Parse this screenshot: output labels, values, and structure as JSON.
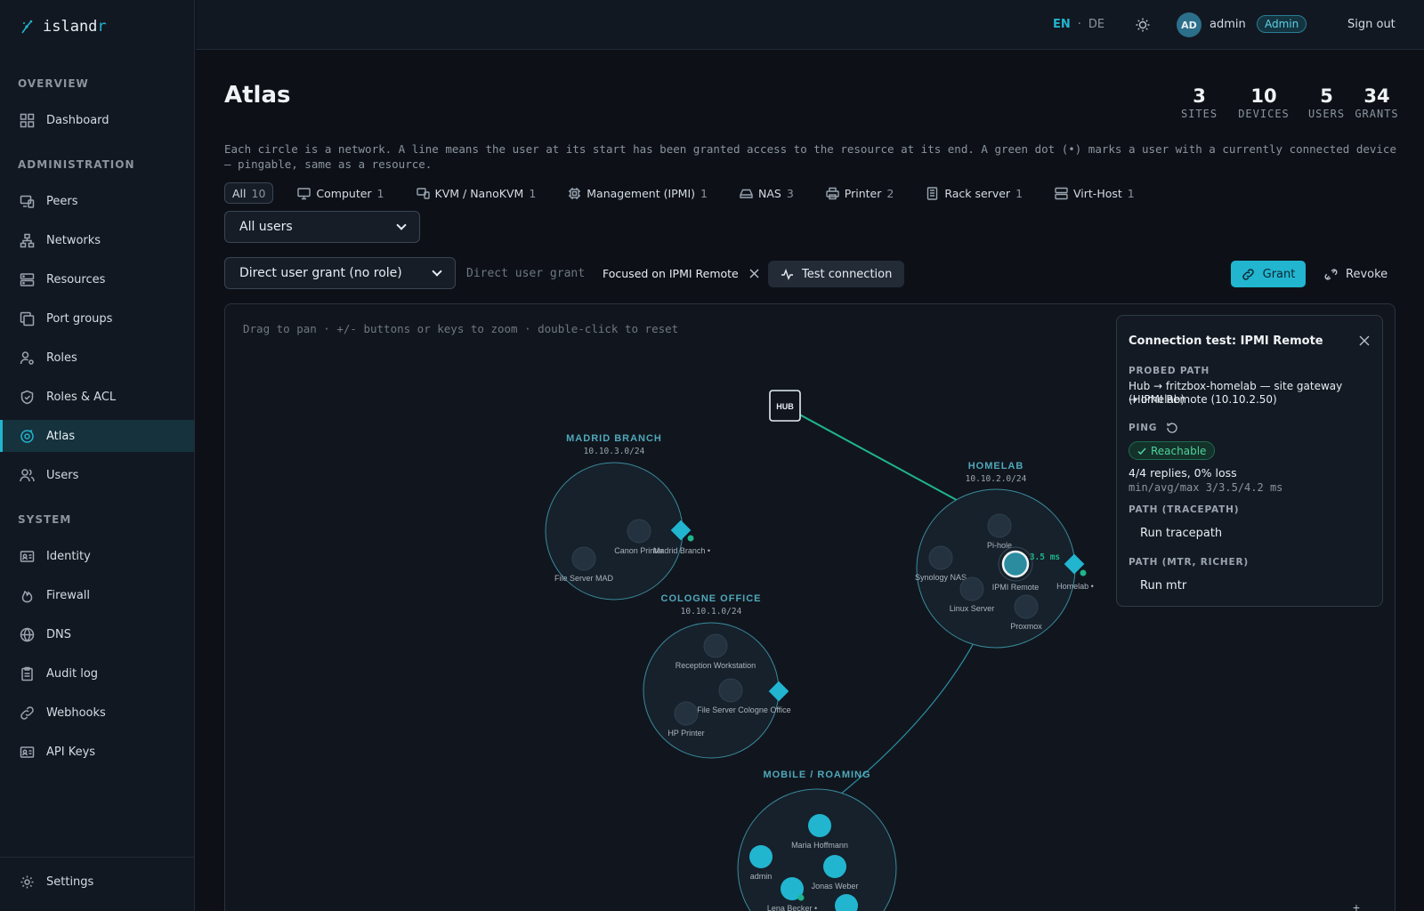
{
  "app": {
    "logo_text": "island",
    "logo_accent": "r"
  },
  "sidebar": {
    "sections": {
      "overview": "OVERVIEW",
      "administration": "ADMINISTRATION",
      "system": "SYSTEM"
    },
    "items": [
      {
        "label": "Dashboard",
        "icon": "grid-icon"
      },
      {
        "label": "Peers",
        "icon": "devices-icon"
      },
      {
        "label": "Networks",
        "icon": "network-icon"
      },
      {
        "label": "Resources",
        "icon": "server-icon"
      },
      {
        "label": "Port groups",
        "icon": "copy-icon"
      },
      {
        "label": "Roles",
        "icon": "user-cog-icon"
      },
      {
        "label": "Roles & ACL",
        "icon": "shield-icon"
      },
      {
        "label": "Atlas",
        "icon": "atlas-icon",
        "active": true
      },
      {
        "label": "Users",
        "icon": "users-icon"
      },
      {
        "label": "Identity",
        "icon": "id-card-icon"
      },
      {
        "label": "Firewall",
        "icon": "flame-icon"
      },
      {
        "label": "DNS",
        "icon": "globe-icon"
      },
      {
        "label": "Audit log",
        "icon": "clipboard-icon"
      },
      {
        "label": "Webhooks",
        "icon": "link-icon"
      },
      {
        "label": "API Keys",
        "icon": "key-card-icon"
      }
    ],
    "settings": "Settings"
  },
  "topbar": {
    "lang_en": "EN",
    "lang_sep": "·",
    "lang_de": "DE",
    "avatar": "AD",
    "username": "admin",
    "role": "Admin",
    "signout": "Sign out"
  },
  "page": {
    "title": "Atlas",
    "stats": [
      {
        "value": "3",
        "label": "SITES"
      },
      {
        "value": "10",
        "label": "DEVICES"
      },
      {
        "value": "5",
        "label": "USERS"
      },
      {
        "value": "34",
        "label": "GRANTS"
      }
    ],
    "description": "Each circle is a network. A line means the user at its start has been granted access to the resource at its end. A green dot (•) marks a user with a currently connected device — pingable, same as a resource."
  },
  "filters": [
    {
      "label": "All",
      "count": "10",
      "active": true
    },
    {
      "label": "Computer",
      "count": "1"
    },
    {
      "label": "KVM / NanoKVM",
      "count": "1"
    },
    {
      "label": "Management (IPMI)",
      "count": "1"
    },
    {
      "label": "NAS",
      "count": "3"
    },
    {
      "label": "Printer",
      "count": "2"
    },
    {
      "label": "Rack server",
      "count": "1"
    },
    {
      "label": "Virt-Host",
      "count": "1"
    }
  ],
  "controls": {
    "user_select": "All users",
    "grant_select": "Direct user grant (no role)",
    "grant_label": "Direct user grant",
    "focus_tag": "Focused on IPMI Remote",
    "test_button": "Test connection",
    "grant_button": "Grant",
    "revoke_button": "Revoke"
  },
  "canvas": {
    "hint": "Drag to pan · +/- buttons or keys to zoom · double-click to reset",
    "hub": "HUB",
    "zoom_in": "+",
    "latency": "3.5 ms",
    "sites": [
      {
        "name": "MADRID BRANCH",
        "cidr": "10.10.3.0/24"
      },
      {
        "name": "COLOGNE OFFICE",
        "cidr": "10.10.1.0/24"
      },
      {
        "name": "HOMELAB",
        "cidr": "10.10.2.0/24"
      },
      {
        "name": "MOBILE / ROAMING",
        "cidr": ""
      }
    ],
    "nodes": {
      "madrid": [
        "Canon Printer",
        "File Server MAD",
        "Madrid Branch •"
      ],
      "cologne": [
        "Reception Workstation",
        "File Server Cologne Office",
        "HP Printer"
      ],
      "homelab": [
        "Pi-hole",
        "Synology NAS",
        "IPMI Remote",
        "Linux Server",
        "Proxmox",
        "Homelab •"
      ],
      "mobile": [
        "Maria Hoffmann",
        "admin",
        "Jonas Weber",
        "Lena Becker •"
      ]
    }
  },
  "panel": {
    "title": "Connection test: IPMI Remote",
    "probed_heading": "PROBED PATH",
    "probed_line1": "Hub → fritzbox-homelab — site gateway (Homelab)",
    "probed_line2": "→ IPMI Remote (10.10.2.50)",
    "ping_heading": "PING",
    "reachable": "Reachable",
    "replies": "4/4 replies, 0% loss",
    "minavgmax": "min/avg/max 3/3.5/4.2 ms",
    "tracepath_heading": "PATH (TRACEPATH)",
    "tracepath_run": "Run tracepath",
    "mtr_heading": "PATH (MTR, RICHER)",
    "mtr_run": "Run mtr"
  },
  "colors": {
    "accent": "#22b5d0",
    "success": "#1fb58a",
    "bg": "#0d1117"
  }
}
